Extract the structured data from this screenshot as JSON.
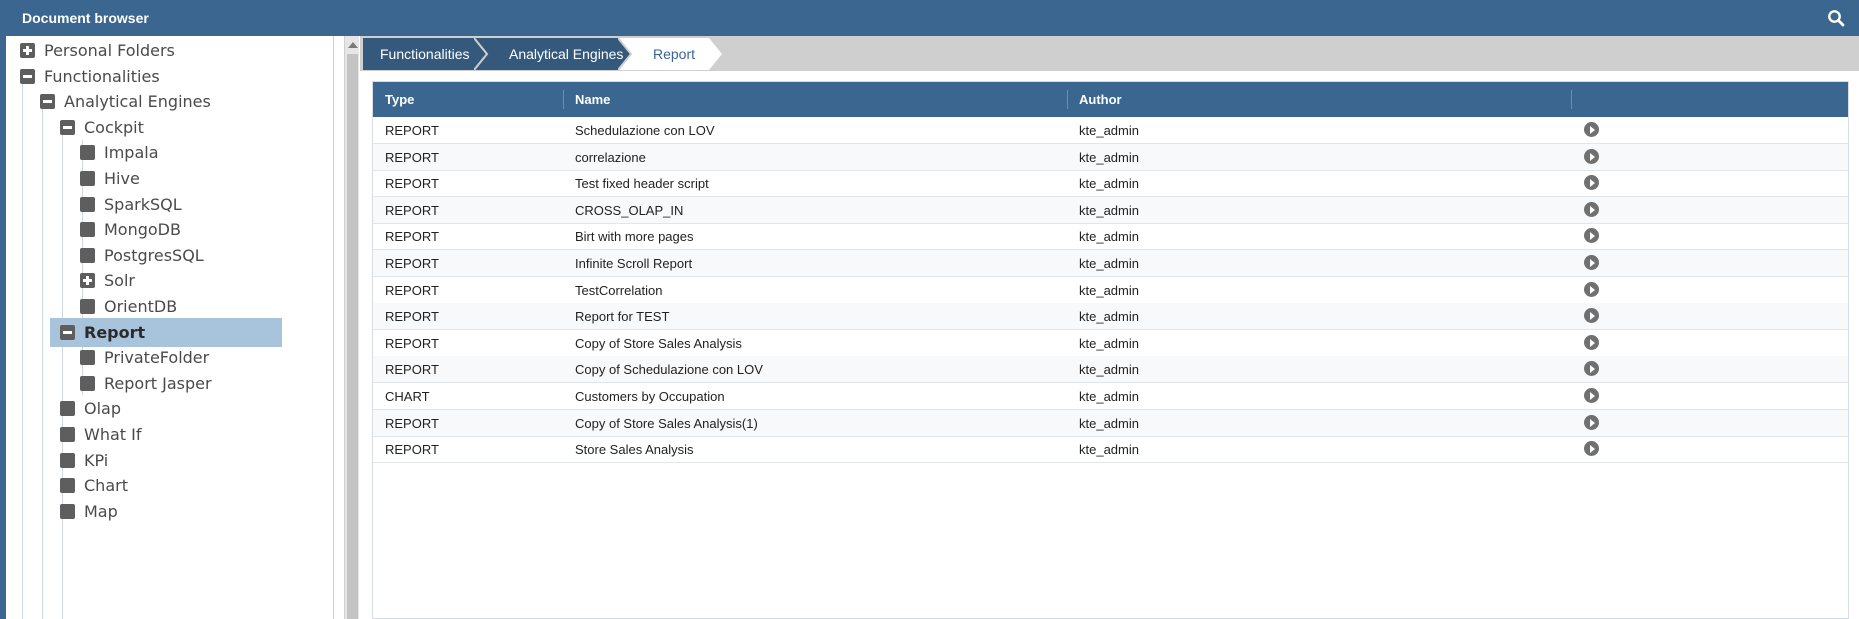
{
  "window": {
    "title": "Document browser",
    "search_icon": "search-icon"
  },
  "tree": {
    "nodes": [
      {
        "label": "Personal Folders",
        "icon": "plus-box-icon",
        "level": 0
      },
      {
        "label": "Functionalities",
        "icon": "minus-box-icon",
        "level": 0
      },
      {
        "label": "Analytical Engines",
        "icon": "minus-box-icon",
        "level": 1
      },
      {
        "label": "Cockpit",
        "icon": "minus-box-icon",
        "level": 2
      },
      {
        "label": "Impala",
        "icon": "folder-square-icon",
        "level": 3
      },
      {
        "label": "Hive",
        "icon": "folder-square-icon",
        "level": 3
      },
      {
        "label": "SparkSQL",
        "icon": "folder-square-icon",
        "level": 3
      },
      {
        "label": "MongoDB",
        "icon": "folder-square-icon",
        "level": 3
      },
      {
        "label": "PostgresSQL",
        "icon": "folder-square-icon",
        "level": 3
      },
      {
        "label": "Solr",
        "icon": "plus-box-icon",
        "level": 3
      },
      {
        "label": "OrientDB",
        "icon": "folder-square-icon",
        "level": 3
      },
      {
        "label": "Report",
        "icon": "minus-box-icon",
        "level": 2,
        "selected": true
      },
      {
        "label": "PrivateFolder",
        "icon": "folder-square-icon",
        "level": 3
      },
      {
        "label": "Report Jasper",
        "icon": "folder-square-icon",
        "level": 3
      },
      {
        "label": "Olap",
        "icon": "folder-square-icon",
        "level": 2
      },
      {
        "label": "What If",
        "icon": "folder-square-icon",
        "level": 2
      },
      {
        "label": "KPi",
        "icon": "folder-square-icon",
        "level": 2
      },
      {
        "label": "Chart",
        "icon": "folder-square-icon",
        "level": 2
      },
      {
        "label": "Map",
        "icon": "folder-square-icon",
        "level": 2
      }
    ]
  },
  "breadcrumb": {
    "items": [
      {
        "label": "Functionalities",
        "active": false
      },
      {
        "label": "Analytical Engines",
        "active": false
      },
      {
        "label": "Report",
        "active": true
      }
    ]
  },
  "table": {
    "columns": [
      "Type",
      "Name",
      "Author",
      ""
    ],
    "rows": [
      {
        "type": "REPORT",
        "name": "Schedulazione con LOV",
        "author": "kte_admin"
      },
      {
        "type": "REPORT",
        "name": "correlazione",
        "author": "kte_admin"
      },
      {
        "type": "REPORT",
        "name": "Test fixed header script",
        "author": "kte_admin"
      },
      {
        "type": "REPORT",
        "name": "CROSS_OLAP_IN",
        "author": "kte_admin"
      },
      {
        "type": "REPORT",
        "name": "Birt with more pages",
        "author": "kte_admin"
      },
      {
        "type": "REPORT",
        "name": "Infinite Scroll Report",
        "author": "kte_admin"
      },
      {
        "type": "REPORT",
        "name": "TestCorrelation",
        "author": "kte_admin"
      },
      {
        "type": "REPORT",
        "name": "Report for TEST",
        "author": "kte_admin"
      },
      {
        "type": "REPORT",
        "name": "Copy of Store Sales Analysis",
        "author": "kte_admin"
      },
      {
        "type": "REPORT",
        "name": "Copy of Schedulazione con LOV",
        "author": "kte_admin"
      },
      {
        "type": "CHART",
        "name": "Customers by Occupation",
        "author": "kte_admin"
      },
      {
        "type": "REPORT",
        "name": "Copy of Store Sales Analysis(1)",
        "author": "kte_admin"
      },
      {
        "type": "REPORT",
        "name": "Store Sales Analysis",
        "author": "kte_admin"
      }
    ],
    "row_action_icon": "play-circle-icon"
  },
  "colors": {
    "header_blue": "#3b6690",
    "breadcrumb_dark": "#34597d",
    "breadcrumb_active": "#ffffff",
    "selected_row": "#a8c4dc"
  }
}
